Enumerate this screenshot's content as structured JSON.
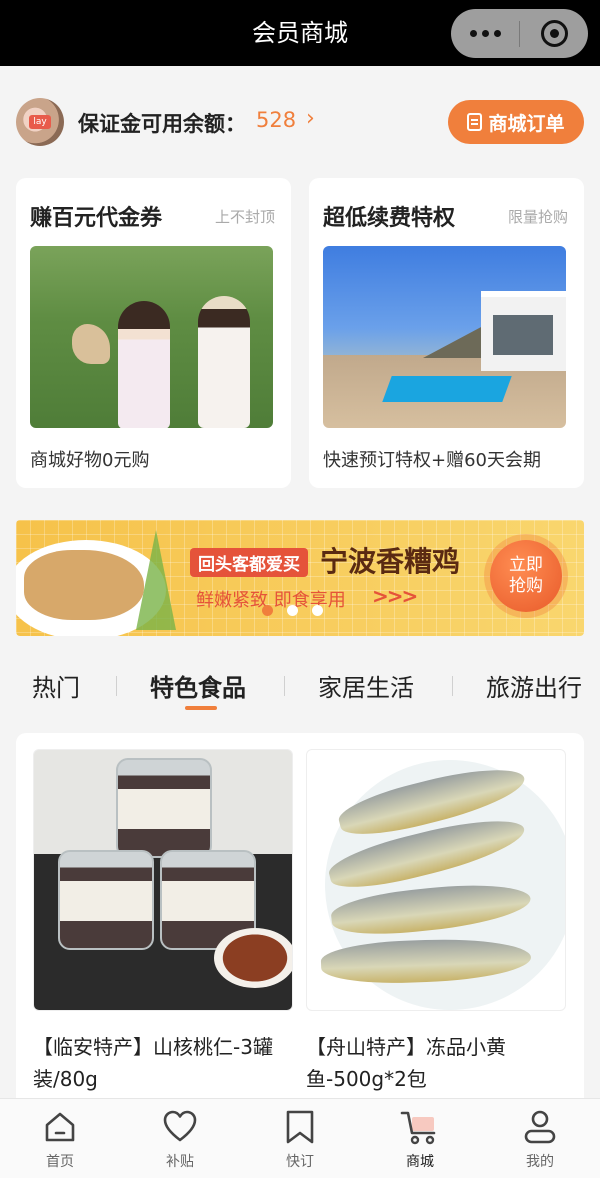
{
  "navbar": {
    "title": "会员商城",
    "more_icon": "more-dots-icon",
    "close_icon": "target-close-icon"
  },
  "balance": {
    "label": "保证金可用余额：",
    "value": "528",
    "arrow": "›",
    "order_button": "商城订单"
  },
  "promo_cards": [
    {
      "title": "赚百元代金券",
      "tag": "上不封顶",
      "desc": "商城好物0元购"
    },
    {
      "title": "超低续费特权",
      "tag": "限量抢购",
      "desc": "快速预订特权+赠60天会期"
    }
  ],
  "banner": {
    "tag": "回头客都爱买",
    "title": "宁波香糟鸡",
    "subtitle": "鲜嫩紧致 即食享用",
    "arrows": ">>>",
    "button": "立即抢购",
    "dots": 3,
    "active_dot": 0
  },
  "tabs": [
    "热门",
    "特色食品",
    "家居生活",
    "旅游出行"
  ],
  "active_tab": 1,
  "goods": [
    {
      "name": "【临安特产】山核桃仁-3罐装/80g"
    },
    {
      "name": "【舟山特产】冻品小黄鱼-500g*2包"
    }
  ],
  "tabbar": [
    {
      "label": "首页",
      "icon": "home-icon"
    },
    {
      "label": "补贴",
      "icon": "heart-icon"
    },
    {
      "label": "快订",
      "icon": "bookmark-icon"
    },
    {
      "label": "商城",
      "icon": "cart-icon"
    },
    {
      "label": "我的",
      "icon": "user-icon"
    }
  ],
  "colors": {
    "accent": "#f07f3c",
    "banner_bg": "#f6c24a",
    "navbar_bg": "#000000"
  }
}
